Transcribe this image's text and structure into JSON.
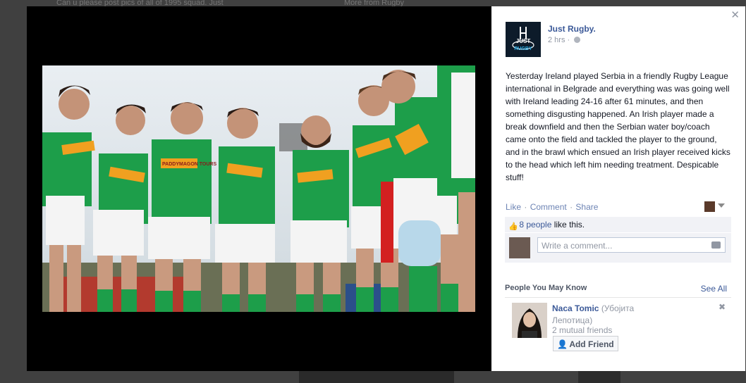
{
  "background": {
    "top_text_left": "Can u please post pics of all of 1995 squad. Just",
    "top_text_right": "More from Rugby"
  },
  "post": {
    "page_name": "Just Rugby.",
    "time": "2 hrs",
    "logo_text_top": "JUST",
    "logo_text_bottom": "RUGBY",
    "text": "Yesterday Ireland played Serbia in a friendly Rugby League international in Belgrade and everything was was going well with Ireland leading 24-16 after 61 minutes, and then something disgusting happened. An Irish player made a break downfield and then the Serbian water boy/coach came onto the field and tackled the player to the ground, and in the brawl which ensued an Irish player received kicks to the head which left him needing treatment. Despicable stuff!",
    "actions": {
      "like": "Like",
      "comment": "Comment",
      "share": "Share",
      "separator": "·"
    },
    "likes": {
      "count_text": "8 people",
      "suffix": " like this."
    },
    "comment_placeholder": "Write a comment..."
  },
  "photo": {
    "sponsor_text": "PADDYMAGON TOURS",
    "shirt_color": "#1d9e4a"
  },
  "pymk": {
    "title": "People You May Know",
    "see_all": "See All",
    "friend": {
      "name": "Naca Tomic",
      "alt_name": "(Убојита Лепотица)",
      "mutual": "2 mutual friends",
      "add_label": "Add Friend"
    }
  },
  "colors": {
    "link": "#3b5998",
    "muted": "#9197a3"
  }
}
